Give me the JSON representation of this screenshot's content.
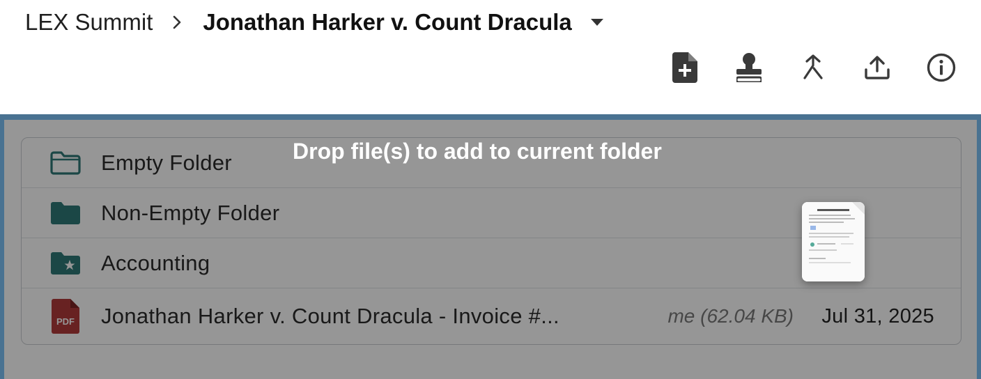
{
  "breadcrumb": {
    "root": "LEX Summit",
    "current": "Jonathan Harker v. Count Dracula"
  },
  "toolbar": {
    "buttons": [
      {
        "icon": "new-document-icon"
      },
      {
        "icon": "stamp-icon"
      },
      {
        "icon": "merge-icon"
      },
      {
        "icon": "upload-icon"
      },
      {
        "icon": "info-icon"
      }
    ]
  },
  "files": [
    {
      "name": "Empty Folder",
      "icon": "folder-outline-icon"
    },
    {
      "name": "Non-Empty Folder",
      "icon": "folder-filled-icon"
    },
    {
      "name": "Accounting",
      "icon": "folder-star-icon"
    },
    {
      "name": "Jonathan Harker v. Count Dracula - Invoice #...",
      "icon": "pdf-icon",
      "meta": "me (62.04 KB)",
      "date": "Jul 31, 2025"
    }
  ],
  "dropzone": {
    "message": "Drop file(s) to add to current folder"
  },
  "colors": {
    "accent": "#7cc2f7",
    "folder": "#2e7a78",
    "pdf": "#b23a3a"
  }
}
